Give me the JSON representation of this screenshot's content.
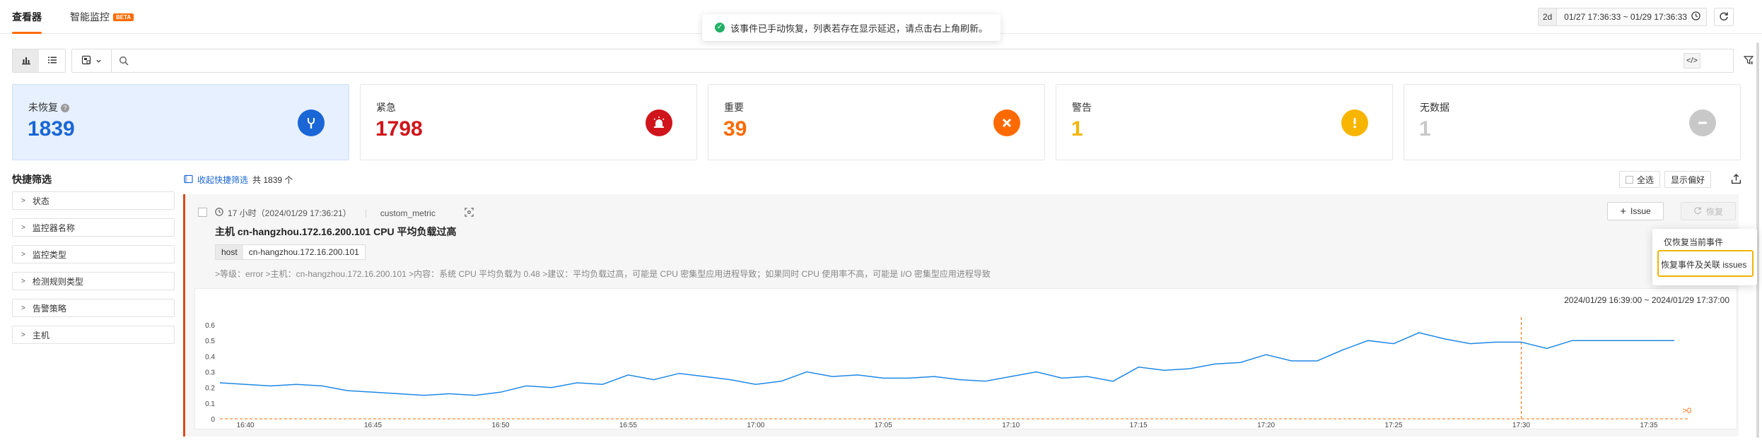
{
  "tabs": [
    {
      "label": "查看器",
      "active": true
    },
    {
      "label": "智能监控",
      "badge": "BETA",
      "active": false
    }
  ],
  "toast": {
    "message": "该事件已手动恢复，列表若存在显示延迟，请点击右上角刷新。"
  },
  "time_picker": {
    "duration": "2d",
    "range": "01/27 17:36:33 ~ 01/29 17:36:33"
  },
  "search": {
    "placeholder": "",
    "code_label": "</>"
  },
  "stats": [
    {
      "label": "未恢复",
      "value": "1839",
      "color": "#1a66d6",
      "icon": "wrench-icon"
    },
    {
      "label": "紧急",
      "value": "1798",
      "color": "#d0141b",
      "icon": "siren-icon"
    },
    {
      "label": "重要",
      "value": "39",
      "color": "#ff6a00",
      "icon": "x-icon"
    },
    {
      "label": "警告",
      "value": "1",
      "color": "#f7b500",
      "icon": "exclamation-icon"
    },
    {
      "label": "无数据",
      "value": "1",
      "color": "#c8c8c8",
      "icon": "minus-icon"
    }
  ],
  "quick_filter": {
    "title": "快捷筛选",
    "items": [
      "状态",
      "监控器名称",
      "监控类型",
      "检测规则类型",
      "告警策略",
      "主机"
    ]
  },
  "list_header": {
    "collapse_label": "收起快捷筛选",
    "total_label": "共 1839 个",
    "select_all": "全选",
    "display_pref": "显示偏好"
  },
  "event": {
    "time": "17 小时（2024/01/29 17:36:21）",
    "source": "custom_metric",
    "title": "主机 cn-hangzhou.172.16.200.101 CPU 平均负载过高",
    "tag_key": "host",
    "tag_value": "cn-hangzhou.172.16.200.101",
    "description": ">等级：error >主机：cn-hangzhou.172.16.200.101 >内容：系统 CPU 平均负载为 0.48 >建议：平均负载过高，可能是 CPU 密集型应用进程导致；如果同时 CPU 使用率不高，可能是 I/O 密集型应用进程导致",
    "issue_btn": "Issue",
    "restore_btn": "恢复",
    "chart_range": "2024/01/29 16:39:00 ~ 2024/01/29 17:37:00"
  },
  "restore_menu": {
    "options": [
      "仅恢复当前事件",
      "恢复事件及关联 issues"
    ]
  },
  "chart_data": {
    "type": "line",
    "ylim": [
      0,
      0.6
    ],
    "y_ticks": [
      "0",
      "0.1",
      "0.2",
      "0.3",
      "0.4",
      "0.5",
      "0.6"
    ],
    "x_ticks": [
      "16:40",
      "16:45",
      "16:50",
      "16:55",
      "17:00",
      "17:05",
      "17:10",
      "17:15",
      "17:20",
      "17:25",
      "17:30",
      "17:35"
    ],
    "threshold_label": ">0",
    "threshold": 0,
    "marker_time_min": 51,
    "x_minutes": [
      0,
      1,
      2,
      3,
      4,
      5,
      6,
      7,
      8,
      9,
      10,
      11,
      12,
      13,
      14,
      15,
      16,
      17,
      18,
      19,
      20,
      21,
      22,
      23,
      24,
      25,
      26,
      27,
      28,
      29,
      30,
      31,
      32,
      33,
      34,
      35,
      36,
      37,
      38,
      39,
      40,
      41,
      42,
      43,
      44,
      45,
      46,
      47,
      48,
      49,
      50,
      51,
      52,
      53,
      54,
      55,
      56,
      57
    ],
    "series": [
      {
        "color": "#1e88e5",
        "values": [
          0.23,
          0.22,
          0.21,
          0.22,
          0.21,
          0.18,
          0.17,
          0.16,
          0.15,
          0.16,
          0.15,
          0.17,
          0.21,
          0.2,
          0.23,
          0.22,
          0.28,
          0.25,
          0.29,
          0.27,
          0.25,
          0.22,
          0.24,
          0.3,
          0.27,
          0.28,
          0.26,
          0.26,
          0.27,
          0.25,
          0.24,
          0.27,
          0.3,
          0.26,
          0.27,
          0.24,
          0.33,
          0.31,
          0.32,
          0.35,
          0.36,
          0.41,
          0.37,
          0.37,
          0.44,
          0.5,
          0.48,
          0.55,
          0.51,
          0.48,
          0.49,
          0.49,
          0.45,
          0.5,
          0.5,
          0.5,
          0.5,
          0.5
        ]
      }
    ]
  }
}
